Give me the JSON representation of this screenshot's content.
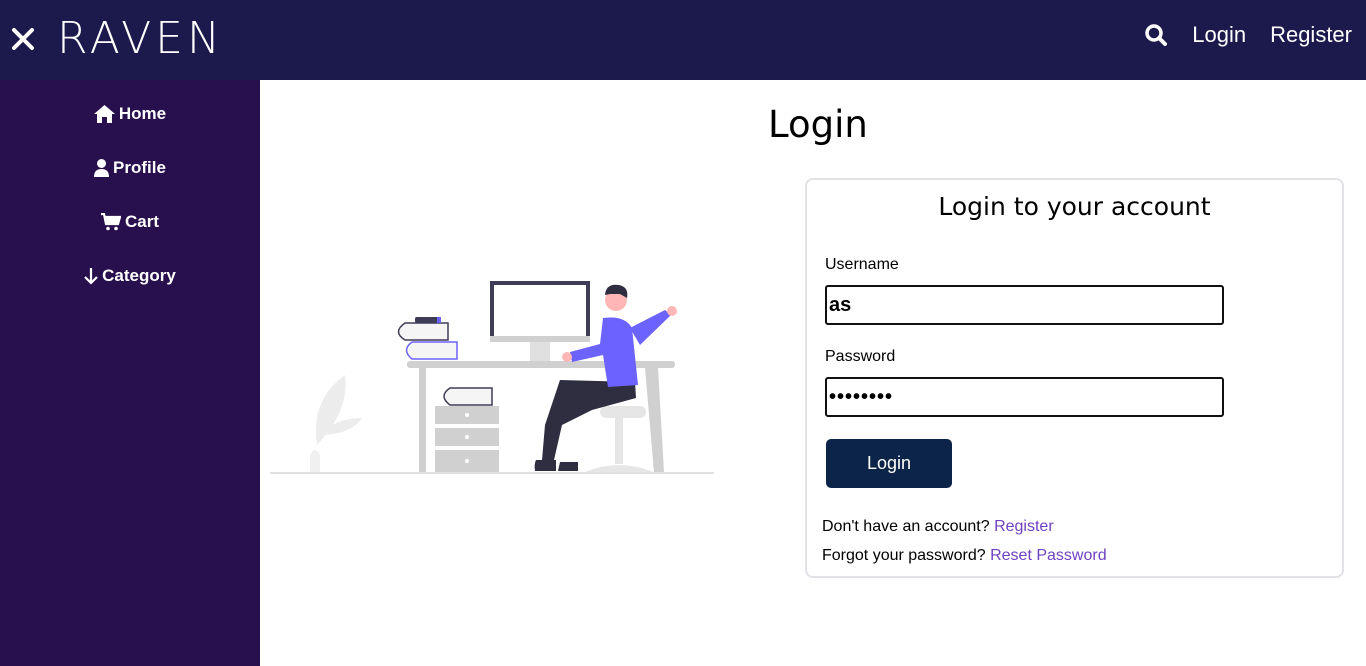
{
  "header": {
    "brand": "RAVEN",
    "nav": {
      "login": "Login",
      "register": "Register"
    },
    "icons": {
      "close": "close-icon",
      "search": "search-icon"
    },
    "bg_color": "#1c1a4d"
  },
  "sidebar": {
    "bg_color": "#28104e",
    "items": [
      {
        "label": "Home",
        "icon": "home-icon"
      },
      {
        "label": "Profile",
        "icon": "user-icon"
      },
      {
        "label": "Cart",
        "icon": "cart-icon"
      },
      {
        "label": "Category",
        "icon": "arrow-down-icon"
      }
    ]
  },
  "main": {
    "page_title": "Login",
    "illustration": "person-at-desk-illustration",
    "card": {
      "title": "Login to your account",
      "username_label": "Username",
      "username_value": "as",
      "password_label": "Password",
      "password_value": "••••••••",
      "login_button": "Login",
      "register_prompt": "Don't have an account?",
      "register_link": "Register",
      "forgot_prompt": "Forgot your password?",
      "reset_link": "Reset Password",
      "link_color": "#6f42c1",
      "button_color": "#0b2447"
    }
  }
}
